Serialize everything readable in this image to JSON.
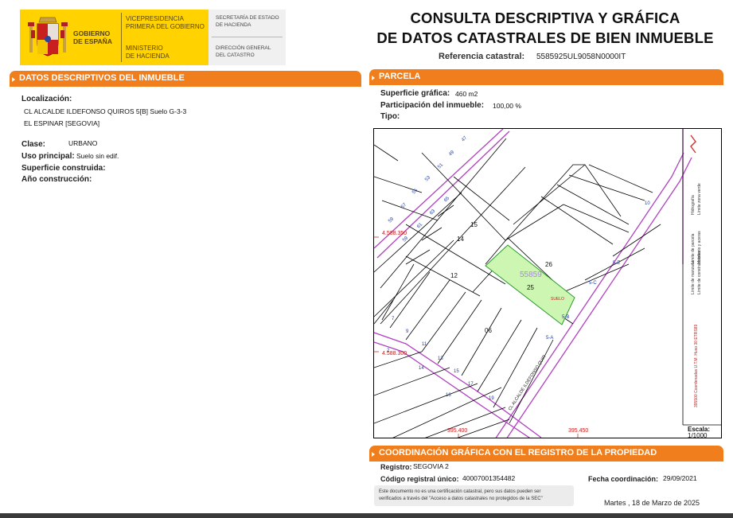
{
  "header": {
    "gobierno": [
      "GOBIERNO",
      "DE ESPAÑA"
    ],
    "vicepresidencia": [
      "VICEPRESIDENCIA",
      "PRIMERA DEL GOBIERNO"
    ],
    "ministerio": [
      "MINISTERIO",
      "DE HACIENDA"
    ],
    "secretaria": [
      "SECRETARÍA DE ESTADO",
      "DE HACIENDA"
    ],
    "direccion": [
      "DIRECCIÓN GENERAL",
      "DEL CATASTRO"
    ],
    "title_line1": "CONSULTA DESCRIPTIVA Y GRÁFICA",
    "title_line2": "DE DATOS CATASTRALES DE BIEN INMUEBLE",
    "ref_label": "Referencia catastral:",
    "ref_value": "5585925UL9058N0000IT"
  },
  "descriptivos": {
    "bar_title": "DATOS DESCRIPTIVOS DEL INMUEBLE",
    "localizacion_label": "Localización:",
    "localizacion_line1": "CL ALCALDE ILDEFONSO QUIROS 5[B] Suelo G-3-3",
    "localizacion_line2": "EL ESPINAR [SEGOVIA]",
    "clase_label": "Clase:",
    "clase_value": "URBANO",
    "uso_label": "Uso principal:",
    "uso_value": "Suelo sin edif.",
    "superficie_construida_label": "Superficie construida:",
    "anio_label": "Año construcción:"
  },
  "parcela": {
    "bar_title": "PARCELA",
    "superficie_label": "Superficie gráfica:",
    "superficie_value": "460 m2",
    "participacion_label": "Participación del inmueble:",
    "participacion_value": "100,00 %",
    "tipo_label": "Tipo:"
  },
  "map": {
    "parcel_numbers": [
      "15",
      "14",
      "12",
      "26",
      "25",
      "06"
    ],
    "parcel_ref": "55859",
    "suelo_label": "SUELO",
    "street_label": "CL ALCALDE ILDEFONSO QUIR",
    "coord_y1": "4.588.350",
    "coord_y2": "4.588.300",
    "coord_x1": "395.400",
    "coord_x2": "395.450",
    "scale_label": "Escala:",
    "scale_value": "1/1000",
    "legend_top": [
      "Hidrografía",
      "Límite zona verde"
    ],
    "legend_mid": [
      "Límite de parcela",
      "Mobiliario y aceras"
    ],
    "legend_low": [
      "Límite de manzana",
      "Límite de construcciones"
    ],
    "legend_coords": "395500 Coordenadas U.T.M. Huso 30 ETRS89"
  },
  "coordinacion": {
    "bar_title": "COORDINACIÓN GRÁFICA CON EL REGISTRO DE LA PROPIEDAD",
    "registro_label": "Registro:",
    "registro_value": "SEGOVIA 2",
    "codigo_label": "Código registral único:",
    "codigo_value": "40007001354482",
    "fecha_label": "Fecha coordinación:",
    "fecha_value": "29/09/2021",
    "note_line1": "Este documento no es una certificación catastral, pero sus datos pueden ser",
    "note_line2": "verificados a través del \"Acceso a datos catastrales no protegidos de la SEC\""
  },
  "footer": {
    "date": "Martes , 18 de Marzo de 2025"
  },
  "colors": {
    "orange": "#f07e1c",
    "yellow": "#ffd200",
    "parcel_fill": "#cdf6b2",
    "manzana_line": "#b040c0",
    "coord_red": "#d03030"
  }
}
